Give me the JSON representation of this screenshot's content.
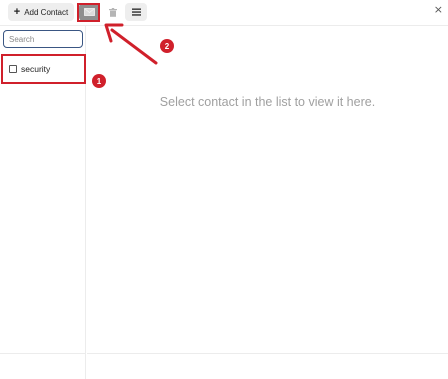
{
  "toolbar": {
    "add_contact_label": "Add Contact",
    "add_icon": "plus-icon",
    "mail_icon": "envelope-icon",
    "trash_icon": "trash-icon",
    "menu_icon": "hamburger-menu-icon",
    "close_glyph": "×"
  },
  "sidebar": {
    "search_placeholder": "Search",
    "contacts": [
      {
        "label": "security",
        "checked": false
      }
    ]
  },
  "main": {
    "empty_message": "Select contact in the list to view it here."
  },
  "annotations": {
    "color": "#d0202b",
    "steps": [
      {
        "number": "1",
        "target": "contact-item-security"
      },
      {
        "number": "2",
        "target": "send-email-button"
      }
    ]
  }
}
